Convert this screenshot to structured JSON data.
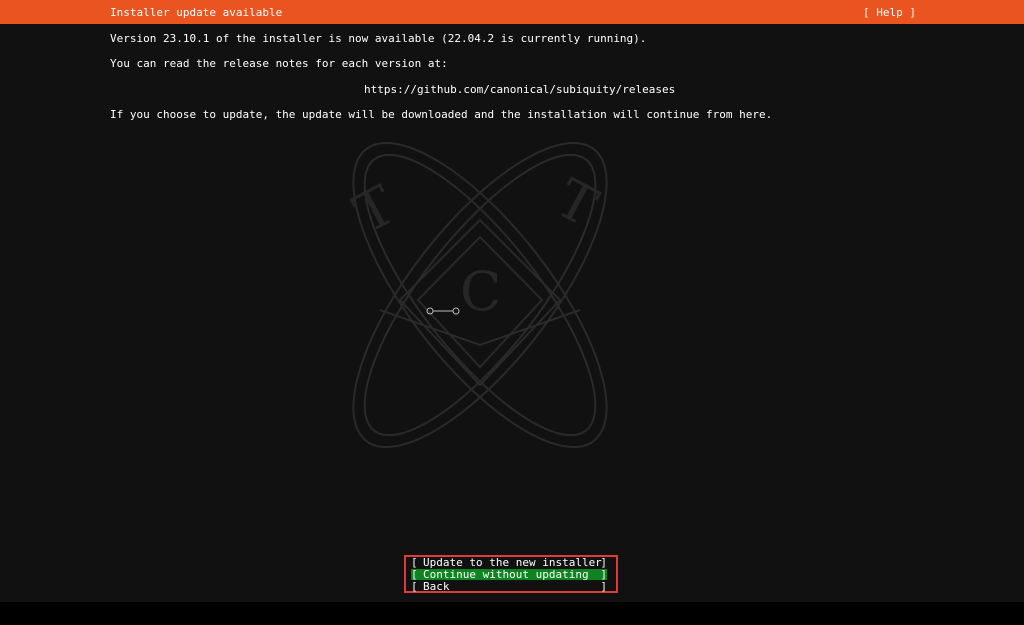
{
  "header": {
    "title": "Installer update available",
    "help_label": "[ Help ]"
  },
  "body": {
    "version_line": "Version 23.10.1 of the installer is now available (22.04.2 is currently running).",
    "notes_line": "You can read the release notes for each version at:",
    "url": "https://github.com/canonical/subiquity/releases",
    "update_line": "If you choose to update, the update will be downloaded and the installation will continue from here."
  },
  "buttons": [
    {
      "label": "Update to the new installer",
      "selected": false
    },
    {
      "label": "Continue without updating",
      "selected": true
    },
    {
      "label": "Back",
      "selected": false
    }
  ],
  "watermark": {
    "letters": [
      "T",
      "T",
      "C"
    ]
  },
  "colors": {
    "header_bg": "#e95420",
    "selected_bg": "#0e8420",
    "highlight_border": "#e03a3a",
    "screen_bg": "#111111"
  }
}
